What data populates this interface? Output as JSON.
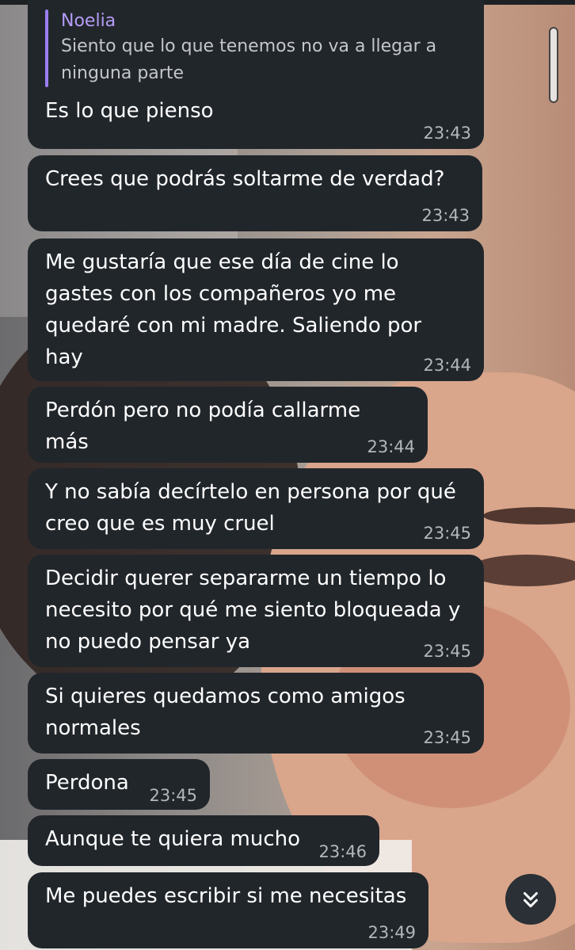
{
  "reply": {
    "name": "Noelia",
    "quote": "Siento que lo que tenemos no va a llegar a\nninguna parte"
  },
  "messages": [
    {
      "text": "Es lo que pienso",
      "time": "23:43"
    },
    {
      "text": "Crees que podrás soltarme de verdad?",
      "time": "23:43"
    },
    {
      "text": "Me gustaría que ese día de cine lo\ngastes con los compañeros yo me\nquedaré con mi madre. Saliendo por\nhay",
      "time": "23:44"
    },
    {
      "text": "Perdón pero no podía callarme más",
      "time": "23:44"
    },
    {
      "text": "Y no sabía decírtelo en persona por qué\ncreo que es muy cruel",
      "time": "23:45"
    },
    {
      "text": "Decidir querer separarme un tiempo lo\nnecesito por qué me siento bloqueada y\nno puedo pensar ya",
      "time": "23:45"
    },
    {
      "text": "Si quieres quedamos como amigos\nnormales",
      "time": "23:45"
    },
    {
      "text": "Perdona",
      "time": "23:45"
    },
    {
      "text": "Aunque te quiera mucho",
      "time": "23:46"
    },
    {
      "text": "Me puedes escribir si me necesitas",
      "time": "23:49"
    }
  ],
  "icons": {
    "scroll_down": "chevrons-down-icon"
  },
  "colors": {
    "bubble": "#21262b",
    "reply_accent": "#9b7ef0",
    "time": "#b3b7bb"
  }
}
